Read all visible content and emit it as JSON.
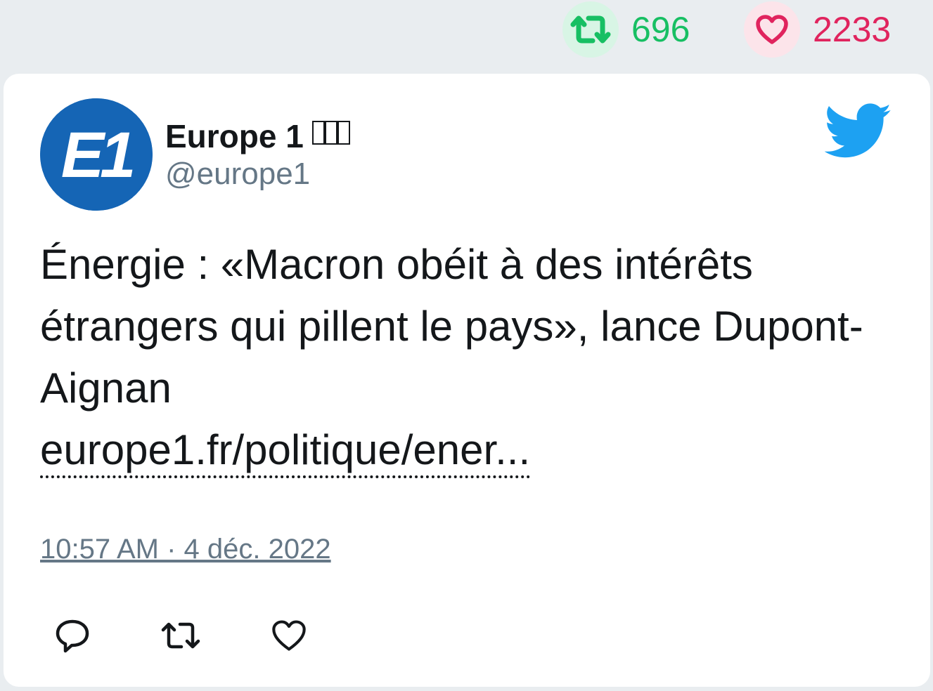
{
  "stats": {
    "retweet_count": "696",
    "like_count": "2233",
    "retweet_icon": "retweet-icon",
    "like_icon": "heart-icon",
    "retweet_color": "#17bf63",
    "like_color": "#e0245e"
  },
  "tweet": {
    "author": {
      "display_name": "Europe 1",
      "handle": "@europe1",
      "avatar_text": "E1",
      "avatar_color": "#1565b5",
      "flag_icon": "french-flag-icon"
    },
    "text": "Énergie : «Macron obéit à des intérêts étrangers qui pillent le pays», lance Dupont-Aignan",
    "link": "europe1.fr/politique/ener...",
    "timestamp": "10:57 AM · 4 déc. 2022",
    "brand_icon": "twitter-bird-icon",
    "brand_color": "#1da1f2",
    "actions": [
      {
        "icon": "reply-icon"
      },
      {
        "icon": "retweet-icon"
      },
      {
        "icon": "like-icon"
      }
    ]
  }
}
